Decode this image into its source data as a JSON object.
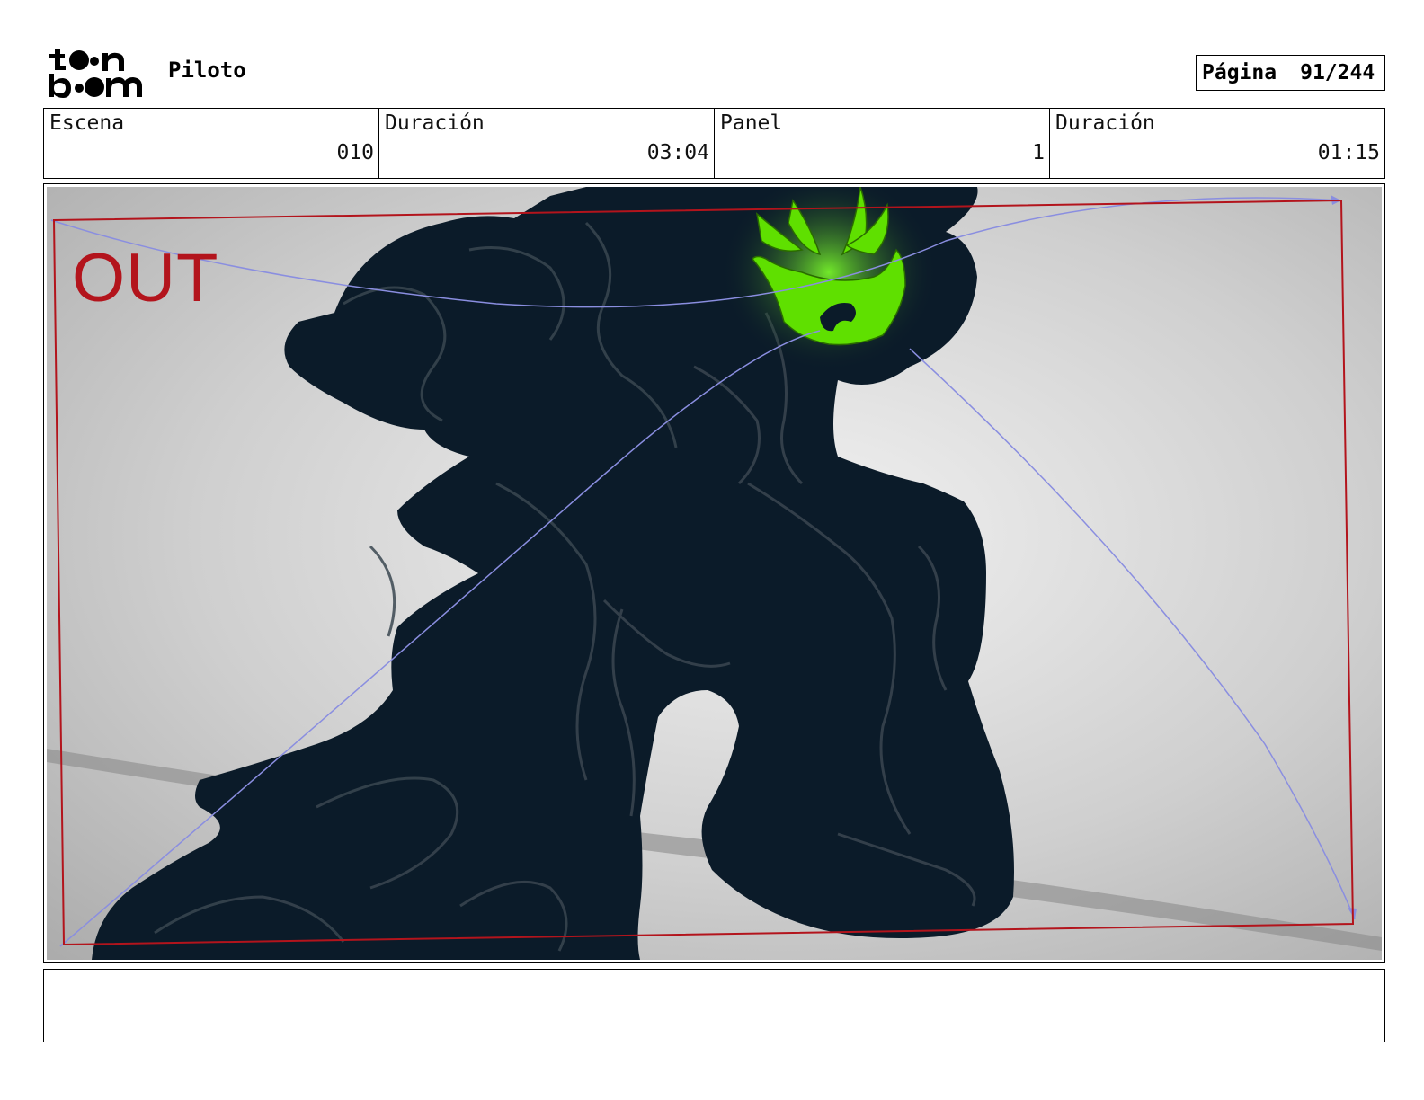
{
  "header": {
    "logo_text": "toon boom",
    "project_title": "Piloto",
    "page_label": "Página",
    "page_number": "91/244"
  },
  "info": {
    "scene_label": "Escena",
    "scene_value": "010",
    "scene_duration_label": "Duración",
    "scene_duration_value": "03:04",
    "panel_label": "Panel",
    "panel_value": "1",
    "panel_duration_label": "Duración",
    "panel_duration_value": "01:15"
  },
  "panel": {
    "camera_label": "OUT"
  },
  "colors": {
    "camera_frame": "#b3141c",
    "silhouette": "#0b1b29",
    "glow": "#5fe000",
    "motion_path": "#8a8ee0"
  }
}
